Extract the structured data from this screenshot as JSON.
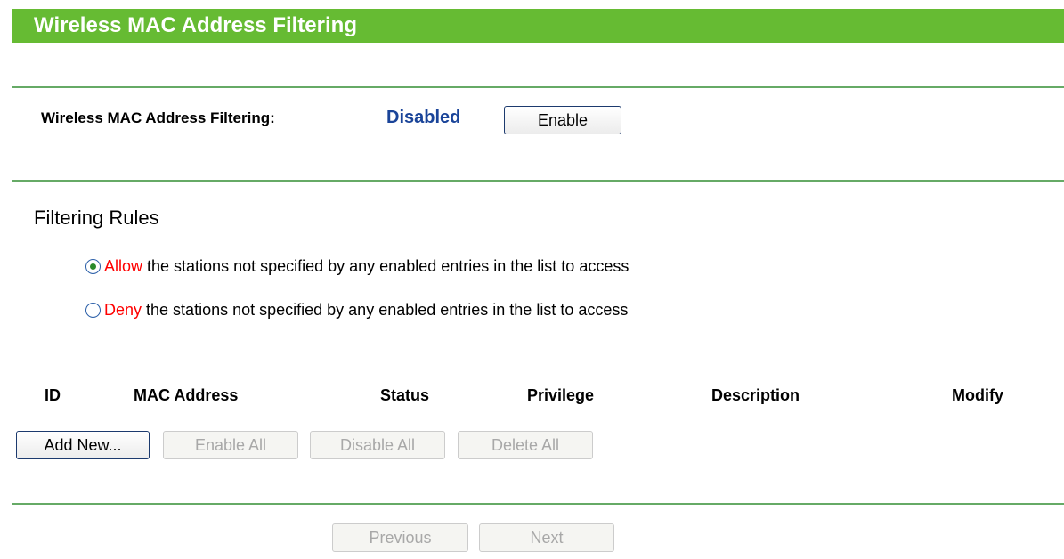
{
  "header": {
    "title": "Wireless MAC Address Filtering"
  },
  "filtering": {
    "label": "Wireless MAC Address Filtering:",
    "status": "Disabled",
    "enable_button": "Enable"
  },
  "rules": {
    "heading": "Filtering Rules",
    "allow": {
      "keyword": "Allow",
      "text": "the stations not specified by any enabled entries in the list to access",
      "selected": true
    },
    "deny": {
      "keyword": "Deny",
      "text": "the stations not specified by any enabled entries in the list to access",
      "selected": false
    }
  },
  "table": {
    "columns": [
      "ID",
      "MAC Address",
      "Status",
      "Privilege",
      "Description",
      "Modify"
    ],
    "rows": []
  },
  "actions": {
    "add_new": "Add New...",
    "enable_all": "Enable All",
    "disable_all": "Disable All",
    "delete_all": "Delete All"
  },
  "pagination": {
    "previous": "Previous",
    "next": "Next"
  },
  "colors": {
    "header_bar": "#66bb33",
    "divider": "#66aa66",
    "status_text": "#1a4499",
    "rule_keyword": "#ff0000"
  }
}
